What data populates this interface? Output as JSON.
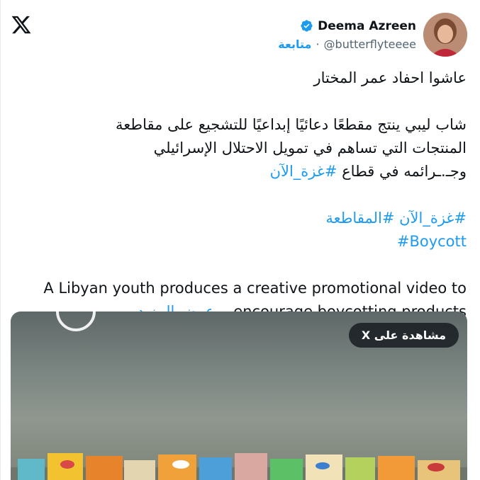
{
  "user": {
    "display_name": "Deema Azreen",
    "handle": "@butterflyteeee",
    "follow_label": "متابعة"
  },
  "tweet": {
    "line1": "عاشوا احفاد عمر المختار",
    "para_line1": "شاب ليبي ينتج مقطعًا دعائيًا إبداعيًا للتشجيع على مقاطعة",
    "para_line2": "المنتجات التي تساهم في تمويل الاحتلال الإسرائيلي",
    "para_line3_text": "وجـ.ـرائمه في قطاع ",
    "para_line3_tag": "#غزة_الآن",
    "tags_line1": "#غزة_الآن #المقاطعة",
    "tags_line2": "#Boycott",
    "en_line1": "A Libyan youth produces a creative promotional video to",
    "en_line2": "encourage boycotting products...",
    "show_more": "عرض المزيد"
  },
  "media": {
    "watch_label": "مشاهدة على X"
  },
  "colors": {
    "link": "#1d9bf0",
    "text": "#0f1419",
    "muted": "#536471"
  }
}
